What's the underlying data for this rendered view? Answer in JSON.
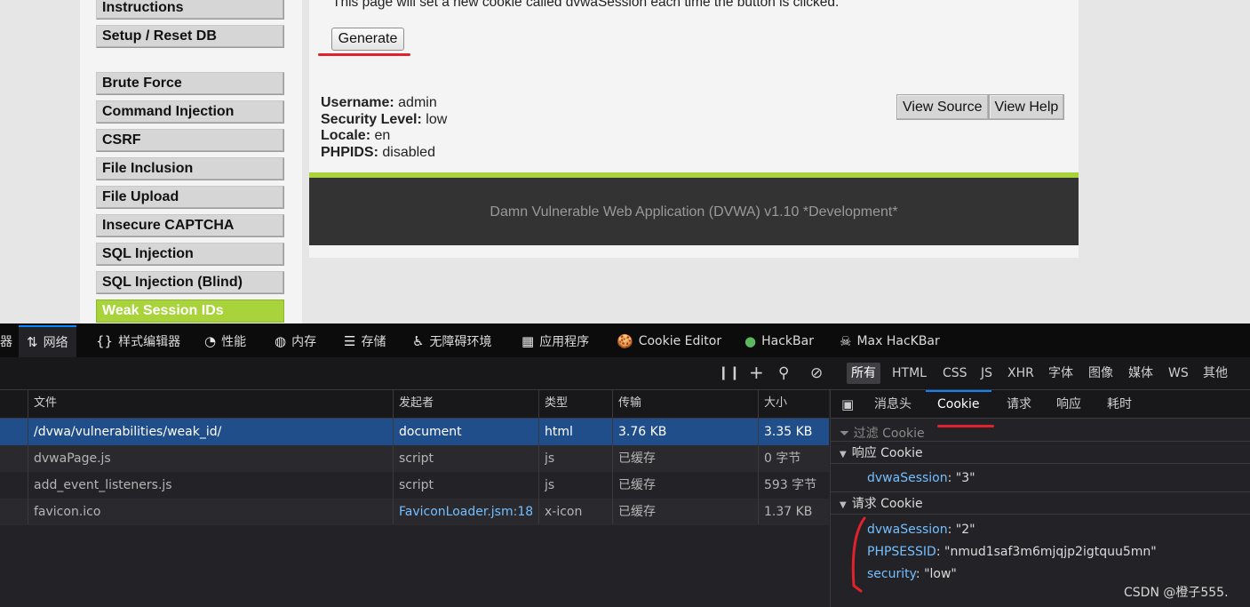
{
  "menu": [
    {
      "label": "Instructions",
      "active": false
    },
    {
      "label": "Setup / Reset DB",
      "active": false
    },
    {
      "label": "Brute Force",
      "active": false
    },
    {
      "label": "Command Injection",
      "active": false
    },
    {
      "label": "CSRF",
      "active": false
    },
    {
      "label": "File Inclusion",
      "active": false
    },
    {
      "label": "File Upload",
      "active": false
    },
    {
      "label": "Insecure CAPTCHA",
      "active": false
    },
    {
      "label": "SQL Injection",
      "active": false
    },
    {
      "label": "SQL Injection (Blind)",
      "active": false
    },
    {
      "label": "Weak Session IDs",
      "active": true
    }
  ],
  "page": {
    "intro": "This page will set a new cookie called dvwaSession each time the button is clicked.",
    "generate_label": "Generate",
    "info": {
      "username_label": "Username:",
      "username": "admin",
      "security_label": "Security Level:",
      "security": "low",
      "locale_label": "Locale:",
      "locale": "en",
      "phpids_label": "PHPIDS:",
      "phpids": "disabled"
    },
    "view_source_label": "View Source",
    "view_help_label": "View Help",
    "footer": "Damn Vulnerable Web Application (DVWA) v1.10 *Development*"
  },
  "devtools": {
    "tabs": [
      {
        "label": "器",
        "icon": "",
        "active": false
      },
      {
        "label": "网络",
        "icon": "⇅",
        "active": true
      },
      {
        "label": "样式编辑器",
        "icon": "{}",
        "active": false
      },
      {
        "label": "性能",
        "icon": "◔",
        "active": false
      },
      {
        "label": "内存",
        "icon": "◍",
        "active": false
      },
      {
        "label": "存储",
        "icon": "☰",
        "active": false
      },
      {
        "label": "无障碍环境",
        "icon": "♿",
        "active": false
      },
      {
        "label": "应用程序",
        "icon": "▦",
        "active": false
      },
      {
        "label": "Cookie Editor",
        "icon": "🍪",
        "active": false
      },
      {
        "label": "HackBar",
        "icon": "●",
        "active": false
      },
      {
        "label": "Max HacKBar",
        "icon": "☠",
        "active": false
      }
    ],
    "filters": [
      "所有",
      "HTML",
      "CSS",
      "JS",
      "XHR",
      "字体",
      "图像",
      "媒体",
      "WS",
      "其他"
    ],
    "active_filter": "所有",
    "columns": [
      "文件",
      "发起者",
      "类型",
      "传输",
      "大小"
    ],
    "rows": [
      {
        "file": "/dvwa/vulnerabilities/weak_id/",
        "initiator": "document",
        "type": "html",
        "transfer": "3.76 KB",
        "size": "3.35 KB",
        "selected": true
      },
      {
        "file": "dvwaPage.js",
        "initiator": "script",
        "type": "js",
        "transfer": "已缓存",
        "size": "0 字节",
        "selected": false
      },
      {
        "file": "add_event_listeners.js",
        "initiator": "script",
        "type": "js",
        "transfer": "已缓存",
        "size": "593 字节",
        "selected": false
      },
      {
        "file": "favicon.ico",
        "initiator": "FaviconLoader.jsm:18...",
        "type": "x-icon",
        "transfer": "已缓存",
        "size": "1.37 KB",
        "selected": false
      }
    ],
    "side_tabs": [
      "消息头",
      "Cookie",
      "请求",
      "响应",
      "耗时"
    ],
    "active_side_tab": "Cookie",
    "filter_placeholder": "过滤 Cookie",
    "response_cookie_title": "响应 Cookie",
    "response_cookies": [
      {
        "name": "dvwaSession",
        "value": "\"3\""
      }
    ],
    "request_cookie_title": "请求 Cookie",
    "request_cookies": [
      {
        "name": "dvwaSession",
        "value": "\"2\""
      },
      {
        "name": "PHPSESSID",
        "value": "\"nmud1saf3m6mjqjp2igtquu5mn\""
      },
      {
        "name": "security",
        "value": "\"low\""
      }
    ]
  },
  "watermark": "CSDN @橙子555.",
  "colors": {
    "accent_green": "#a8d33a",
    "annotation_red": "#e1222a",
    "devtools_blue": "#0a84ff"
  }
}
